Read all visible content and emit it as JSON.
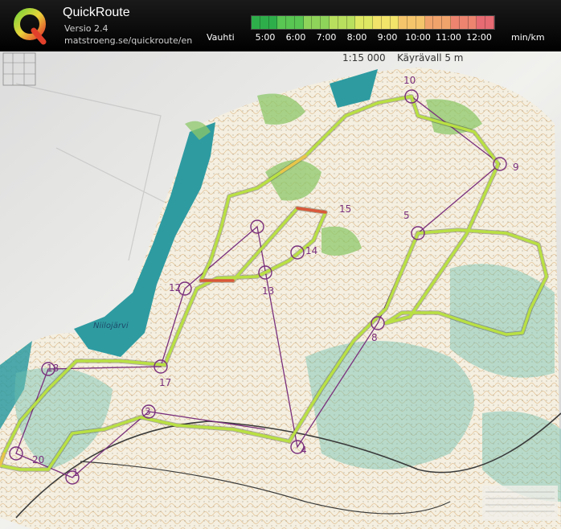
{
  "app": {
    "name": "QuickRoute",
    "version": "Versio 2.4",
    "url": "matstroeng.se/quickroute/en"
  },
  "pace": {
    "label": "Vauhti",
    "unit": "min/km",
    "ticks": [
      "5:00",
      "6:00",
      "7:00",
      "8:00",
      "9:00",
      "10:00",
      "11:00",
      "12:00"
    ],
    "gradient_colors": [
      "#2eae4a",
      "#59c552",
      "#8fd45a",
      "#b9df5e",
      "#dfe862",
      "#f2e36a",
      "#f5c56c",
      "#f1a36c",
      "#ec8470",
      "#e66b72"
    ]
  },
  "map": {
    "scale_text": "1:15 000",
    "event_name": "Käyrävall 5 m",
    "lake_name": "Niilojärvi",
    "controls": [
      "1",
      "3",
      "4",
      "5",
      "8",
      "9",
      "10",
      "12",
      "13",
      "14",
      "15",
      "17",
      "18",
      "20"
    ],
    "colors": {
      "route": "#b9e043",
      "route_fast": "#e8c64a",
      "route_slow": "#d9573b",
      "water": "#2e9ba1",
      "course": "#7a2f7d",
      "paper": "#ebe9e4"
    }
  }
}
